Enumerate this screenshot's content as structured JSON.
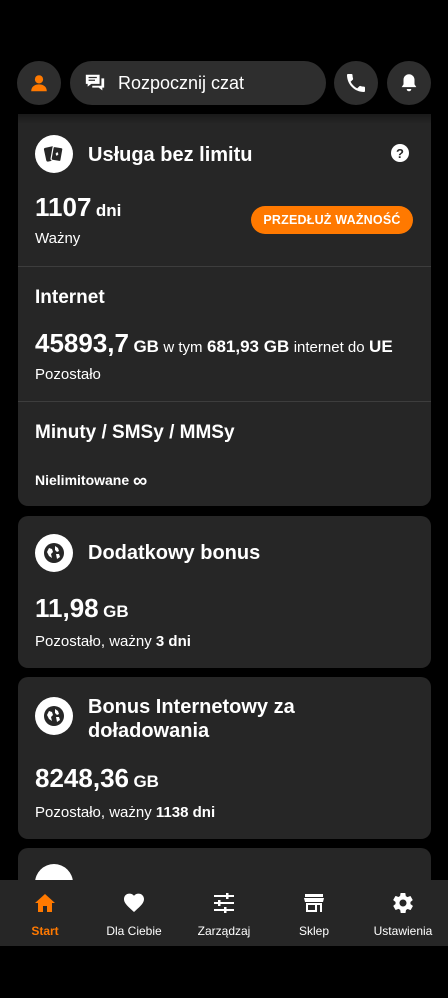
{
  "header": {
    "chat_label": "Rozpocznij czat",
    "icons": [
      "user-icon",
      "chat-icon",
      "phone-icon",
      "bell-icon"
    ]
  },
  "service_card": {
    "title": "Usługa bez limitu",
    "help": "?",
    "days_value": "1107",
    "days_unit": "dni",
    "valid_label": "Ważny",
    "extend_button": "PRZEDŁUŻ WAŻNOŚĆ",
    "internet": {
      "heading": "Internet",
      "value": "45893,7",
      "unit": "GB",
      "in_that": "w tym",
      "eu_value": "681,93 GB",
      "eu_label": "internet do",
      "eu_region": "UE",
      "remaining_label": "Pozostało"
    },
    "minutes": {
      "heading": "Minuty / SMSy / MMSy",
      "unlimited_label": "Nielimitowane",
      "infinity": "∞"
    }
  },
  "bonus_cards": [
    {
      "title": "Dodatkowy bonus",
      "value": "11,98",
      "unit": "GB",
      "remaining_label": "Pozostało, ważny",
      "valid_days": "3 dni"
    },
    {
      "title_line1": "Bonus Internetowy za",
      "title_line2": "doładowania",
      "value": "8248,36",
      "unit": "GB",
      "remaining_label": "Pozostało, ważny",
      "valid_days": "1138 dni"
    }
  ],
  "bottom_nav": [
    {
      "label": "Start",
      "icon": "home-icon",
      "active": true
    },
    {
      "label": "Dla Ciebie",
      "icon": "heart-icon",
      "active": false
    },
    {
      "label": "Zarządzaj",
      "icon": "sliders-icon",
      "active": false
    },
    {
      "label": "Sklep",
      "icon": "store-icon",
      "active": false
    },
    {
      "label": "Ustawienia",
      "icon": "gear-icon",
      "active": false
    }
  ],
  "colors": {
    "accent": "#ff7900",
    "card_bg": "#262626",
    "page_bg": "#000000",
    "text": "#ffffff"
  }
}
